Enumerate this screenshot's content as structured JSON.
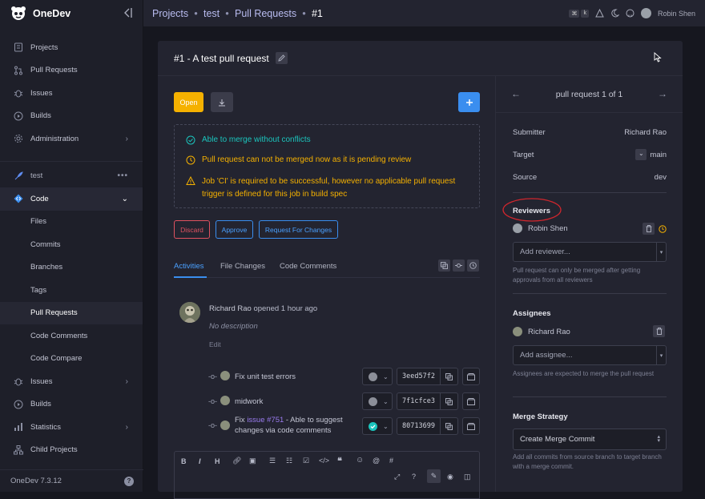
{
  "app": {
    "name": "OneDev",
    "version": "OneDev 7.3.12"
  },
  "sidebar": {
    "top_items": [
      {
        "label": "Projects",
        "icon": "projects-icon"
      },
      {
        "label": "Pull Requests",
        "icon": "pull-request-icon"
      },
      {
        "label": "Issues",
        "icon": "bug-icon"
      },
      {
        "label": "Builds",
        "icon": "play-icon"
      },
      {
        "label": "Administration",
        "icon": "gear-icon"
      }
    ],
    "project": "test",
    "project_items": [
      {
        "label": "Code"
      },
      {
        "label": "Files"
      },
      {
        "label": "Commits"
      },
      {
        "label": "Branches"
      },
      {
        "label": "Tags"
      },
      {
        "label": "Pull Requests"
      },
      {
        "label": "Code Comments"
      },
      {
        "label": "Code Compare"
      },
      {
        "label": "Issues"
      },
      {
        "label": "Builds"
      },
      {
        "label": "Statistics"
      },
      {
        "label": "Child Projects"
      }
    ]
  },
  "topbar": {
    "breadcrumbs": [
      "Projects",
      "test",
      "Pull Requests",
      "#1"
    ],
    "kbd1": "⌘",
    "kbd2": "k",
    "user": "Robin Shen"
  },
  "pr": {
    "title": "#1 - A test pull request",
    "open_label": "Open",
    "statuses": [
      "Able to merge without conflicts",
      "Pull request can not be merged now as it is pending review",
      "Job 'CI' is required to be successful, however no applicable pull request trigger is defined for this job in build spec"
    ],
    "actions": [
      "Discard",
      "Approve",
      "Request For Changes"
    ],
    "tabs": [
      "Activities",
      "File Changes",
      "Code Comments"
    ],
    "activity": {
      "user": "Richard Rao",
      "action": "opened 1 hour ago",
      "description": "No description",
      "edit": "Edit"
    },
    "commits": [
      {
        "message": "Fix unit test errors",
        "hash": "3eed57f2",
        "status": "none"
      },
      {
        "message": "midwork",
        "hash": "7f1cfce3",
        "status": "none"
      },
      {
        "message_prefix": "Fix ",
        "message_link": "issue #751",
        "message_suffix": " - Able to suggest changes via code comments",
        "hash": "80713699",
        "status": "success"
      }
    ]
  },
  "detail": {
    "nav": "pull request 1 of 1",
    "submitter_label": "Submitter",
    "submitter": "Richard Rao",
    "target_label": "Target",
    "target": "main",
    "source_label": "Source",
    "source": "dev",
    "reviewers_title": "Reviewers",
    "reviewer": "Robin Shen",
    "add_reviewer": "Add reviewer...",
    "reviewer_hint": "Pull request can only be merged after getting approvals from all reviewers",
    "assignees_title": "Assignees",
    "assignee": "Richard Rao",
    "add_assignee": "Add assignee...",
    "assignee_hint": "Assignees are expected to merge the pull request",
    "merge_title": "Merge Strategy",
    "merge_strategy": "Create Merge Commit",
    "merge_hint": "Add all commits from source branch to target branch with a merge commit."
  },
  "colors": {
    "accent": "#3a8eef",
    "warning": "#f5b100",
    "success": "#1bc5bd",
    "danger": "#e05260",
    "annotation": "#d0262d"
  }
}
